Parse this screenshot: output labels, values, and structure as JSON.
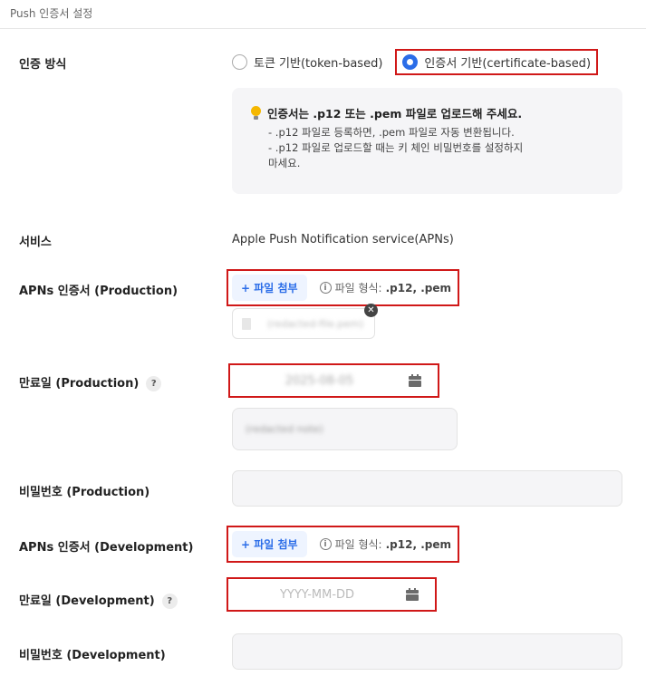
{
  "header": {
    "title": "Push 인증서 설정"
  },
  "auth": {
    "label": "인증 방식",
    "options": [
      {
        "label": "토큰 기반(token-based)",
        "checked": false
      },
      {
        "label": "인증서 기반(certificate-based)",
        "checked": true
      }
    ]
  },
  "info": {
    "title": "인증서는 .p12 또는 .pem 파일로 업로드해 주세요.",
    "lines": [
      "- .p12 파일로 등록하면, .pem 파일로 자동 변환됩니다.",
      "- .p12 파일로 업로드할 때는 키 체인 비밀번호를 설정하지",
      "마세요."
    ]
  },
  "service": {
    "label": "서비스",
    "value": "Apple Push Notification service(APNs)"
  },
  "prod": {
    "cert_label": "APNs 인증서 (Production)",
    "attach_label": "+ 파일 첨부",
    "format_prefix": "파일 형식:",
    "format_value": ".p12, .pem",
    "file_name": "(redacted-file.pem)",
    "expiry_label": "만료일 (Production)",
    "help": "?",
    "expiry_value": "2025-08-05",
    "blurred_note": "(redacted note)",
    "password_label": "비밀번호 (Production)"
  },
  "dev": {
    "cert_label": "APNs 인증서 (Development)",
    "attach_label": "+ 파일 첨부",
    "format_prefix": "파일 형식:",
    "format_value": ".p12, .pem",
    "expiry_label": "만료일 (Development)",
    "help": "?",
    "expiry_placeholder": "YYYY-MM-DD",
    "password_label": "비밀번호 (Development)"
  },
  "colors": {
    "accent": "#2b6de8",
    "highlight": "#d01818",
    "box_bg": "#f5f5f7"
  },
  "icons": [
    "lightbulb-icon",
    "info-icon",
    "calendar-icon",
    "document-icon",
    "close-icon",
    "help-icon"
  ]
}
